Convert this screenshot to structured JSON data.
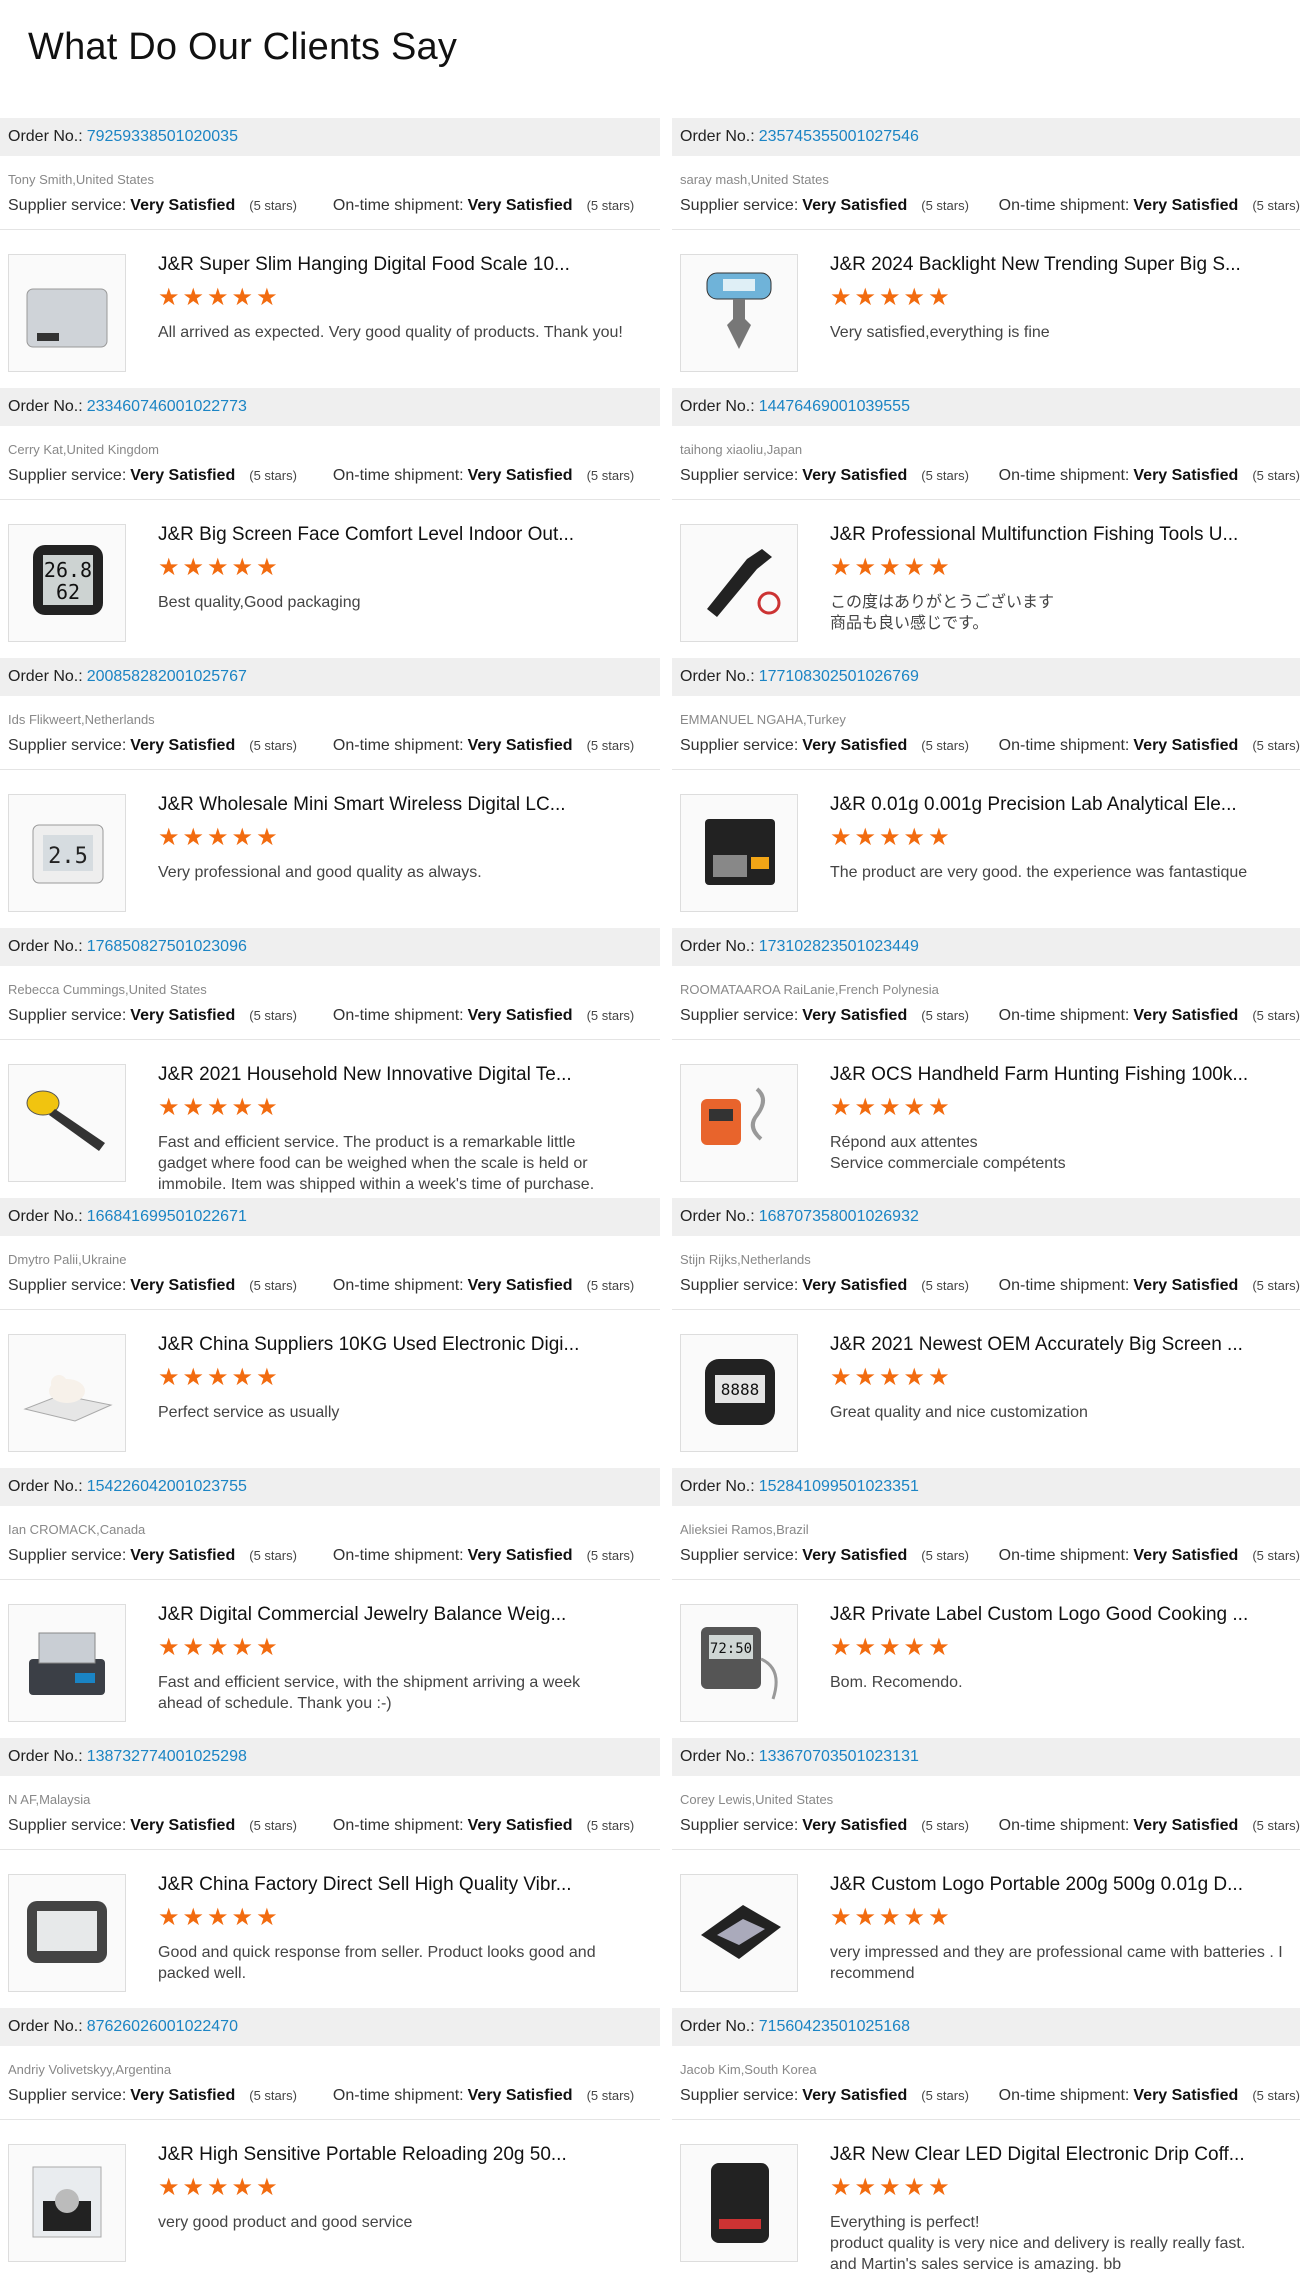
{
  "page": {
    "title": "What Do Our Clients Say"
  },
  "labels": {
    "order_no": "Order No.:",
    "supplier_service": "Supplier service:",
    "ontime_shipment": "On-time shipment:"
  },
  "colors": {
    "accent_link": "#1a84c4",
    "star": "#f26b0f",
    "bar": "#efefef"
  },
  "reviews": [
    {
      "order_no": "79259338501020035",
      "buyer": "Tony Smith,United States",
      "supplier": "Very Satisfied",
      "supplier_stars": "(5 stars)",
      "shipment": "Very Satisfied",
      "shipment_stars": "(5 stars)",
      "product": "J&R Super Slim Hanging Digital Food Scale 10...",
      "rating": 5,
      "review": "All arrived as expected. Very good quality of products. Thank you!",
      "icon": "kitchen-scale-icon"
    },
    {
      "order_no": "235745355001027546",
      "buyer": "saray mash,United States",
      "supplier": "Very Satisfied",
      "supplier_stars": "(5 stars)",
      "shipment": "Very Satisfied",
      "shipment_stars": "(5 stars)",
      "product": "J&R 2024 Backlight New Trending Super Big S...",
      "rating": 5,
      "review": "Very satisfied,everything is fine",
      "icon": "luggage-scale-icon"
    },
    {
      "order_no": "233460746001022773",
      "buyer": "Cerry Kat,United Kingdom",
      "supplier": "Very Satisfied",
      "supplier_stars": "(5 stars)",
      "shipment": "Very Satisfied",
      "shipment_stars": "(5 stars)",
      "product": "J&R Big Screen Face Comfort Level Indoor Out...",
      "rating": 5,
      "review": "Best quality,Good packaging",
      "icon": "hygrometer-icon"
    },
    {
      "order_no": "14476469001039555",
      "buyer": "taihong xiaoliu,Japan",
      "supplier": "Very Satisfied",
      "supplier_stars": "(5 stars)",
      "shipment": "Very Satisfied",
      "shipment_stars": "(5 stars)",
      "product": "J&R Professional Multifunction Fishing Tools U...",
      "rating": 5,
      "review": "この度はありがとうございます\n商品も良い感じです。",
      "icon": "fishing-grip-icon"
    },
    {
      "order_no": "200858282001025767",
      "buyer": "Ids Flikweert,Netherlands",
      "supplier": "Very Satisfied",
      "supplier_stars": "(5 stars)",
      "shipment": "Very Satisfied",
      "shipment_stars": "(5 stars)",
      "product": "J&R Wholesale Mini Smart Wireless Digital LC...",
      "rating": 5,
      "review": "Very professional and good quality as always.",
      "icon": "fridge-thermometer-icon"
    },
    {
      "order_no": "177108302501026769",
      "buyer": "EMMANUEL NGAHA,Turkey",
      "supplier": "Very Satisfied",
      "supplier_stars": "(5 stars)",
      "shipment": "Very Satisfied",
      "shipment_stars": "(5 stars)",
      "product": "J&R 0.01g 0.001g Precision Lab Analytical Ele...",
      "rating": 5,
      "review": "The product are very good. the experience was fantastique",
      "icon": "pocket-scale-icon"
    },
    {
      "order_no": "176850827501023096",
      "buyer": "Rebecca Cummings,United States",
      "supplier": "Very Satisfied",
      "supplier_stars": "(5 stars)",
      "shipment": "Very Satisfied",
      "shipment_stars": "(5 stars)",
      "product": "J&R 2021 Household New Innovative Digital Te...",
      "rating": 5,
      "review": "Fast and efficient service. The product is a remarkable little gadget where food can be weighed when the scale is held or immobile. Item was shipped within a week's time of purchase. Thank you.",
      "icon": "spoon-scale-icon"
    },
    {
      "order_no": "173102823501023449",
      "buyer": "ROOMATAAROA RaiLanie,French Polynesia",
      "supplier": "Very Satisfied",
      "supplier_stars": "(5 stars)",
      "shipment": "Very Satisfied",
      "shipment_stars": "(5 stars)",
      "product": "J&R OCS Handheld Farm Hunting Fishing 100k...",
      "rating": 5,
      "review": "Répond aux attentes\nService commerciale compétents",
      "icon": "crane-scale-icon"
    },
    {
      "order_no": "166841699501022671",
      "buyer": "Dmytro Palii,Ukraine",
      "supplier": "Very Satisfied",
      "supplier_stars": "(5 stars)",
      "shipment": "Very Satisfied",
      "shipment_stars": "(5 stars)",
      "product": "J&R China Suppliers 10KG Used Electronic Digi...",
      "rating": 5,
      "review": "Perfect service as usually",
      "icon": "pet-scale-icon"
    },
    {
      "order_no": "168707358001026932",
      "buyer": "Stijn Rijks,Netherlands",
      "supplier": "Very Satisfied",
      "supplier_stars": "(5 stars)",
      "shipment": "Very Satisfied",
      "shipment_stars": "(5 stars)",
      "product": "J&R 2021 Newest OEM Accurately Big Screen ...",
      "rating": 5,
      "review": "Great quality and nice customization",
      "icon": "timer-icon"
    },
    {
      "order_no": "154226042001023755",
      "buyer": "Ian CROMACK,Canada",
      "supplier": "Very Satisfied",
      "supplier_stars": "(5 stars)",
      "shipment": "Very Satisfied",
      "shipment_stars": "(5 stars)",
      "product": "J&R Digital Commercial Jewelry Balance Weig...",
      "rating": 5,
      "review": "Fast and efficient service, with the shipment arriving a week ahead of schedule. Thank you :-)",
      "icon": "jewelry-scale-icon"
    },
    {
      "order_no": "152841099501023351",
      "buyer": "Alieksiei Ramos,Brazil",
      "supplier": "Very Satisfied",
      "supplier_stars": "(5 stars)",
      "shipment": "Very Satisfied",
      "shipment_stars": "(5 stars)",
      "product": "J&R Private Label Custom Logo Good Cooking ...",
      "rating": 5,
      "review": "Bom. Recomendo.",
      "icon": "cooking-thermometer-icon"
    },
    {
      "order_no": "138732774001025298",
      "buyer": "N AF,Malaysia",
      "supplier": "Very Satisfied",
      "supplier_stars": "(5 stars)",
      "shipment": "Very Satisfied",
      "shipment_stars": "(5 stars)",
      "product": "J&R China Factory Direct Sell High Quality Vibr...",
      "rating": 5,
      "review": "Good and quick response from seller. Product looks good and packed well.",
      "icon": "digital-timer-icon"
    },
    {
      "order_no": "133670703501023131",
      "buyer": "Corey Lewis,United States",
      "supplier": "Very Satisfied",
      "supplier_stars": "(5 stars)",
      "shipment": "Very Satisfied",
      "shipment_stars": "(5 stars)",
      "product": "J&R Custom Logo Portable 200g 500g 0.01g D...",
      "rating": 5,
      "review": "very impressed and they are professional came with batteries . I recommend",
      "icon": "portable-scale-icon"
    },
    {
      "order_no": "87626026001022470",
      "buyer": "Andriy Volivetskyy,Argentina",
      "supplier": "Very Satisfied",
      "supplier_stars": "(5 stars)",
      "shipment": "Very Satisfied",
      "shipment_stars": "(5 stars)",
      "product": "J&R High Sensitive Portable Reloading 20g 50...",
      "rating": 5,
      "review": "very good product and good service",
      "icon": "reloading-scale-icon"
    },
    {
      "order_no": "71560423501025168",
      "buyer": "Jacob Kim,South Korea",
      "supplier": "Very Satisfied",
      "supplier_stars": "(5 stars)",
      "shipment": "Very Satisfied",
      "shipment_stars": "(5 stars)",
      "product": "J&R New Clear LED Digital Electronic Drip Coff...",
      "rating": 5,
      "review": "Everything is perfect!\nproduct quality is very nice and delivery is really really fast.\nand Martin's sales service is amazing. bb\nThank you for everything Martin!",
      "icon": "coffee-scale-icon"
    }
  ]
}
